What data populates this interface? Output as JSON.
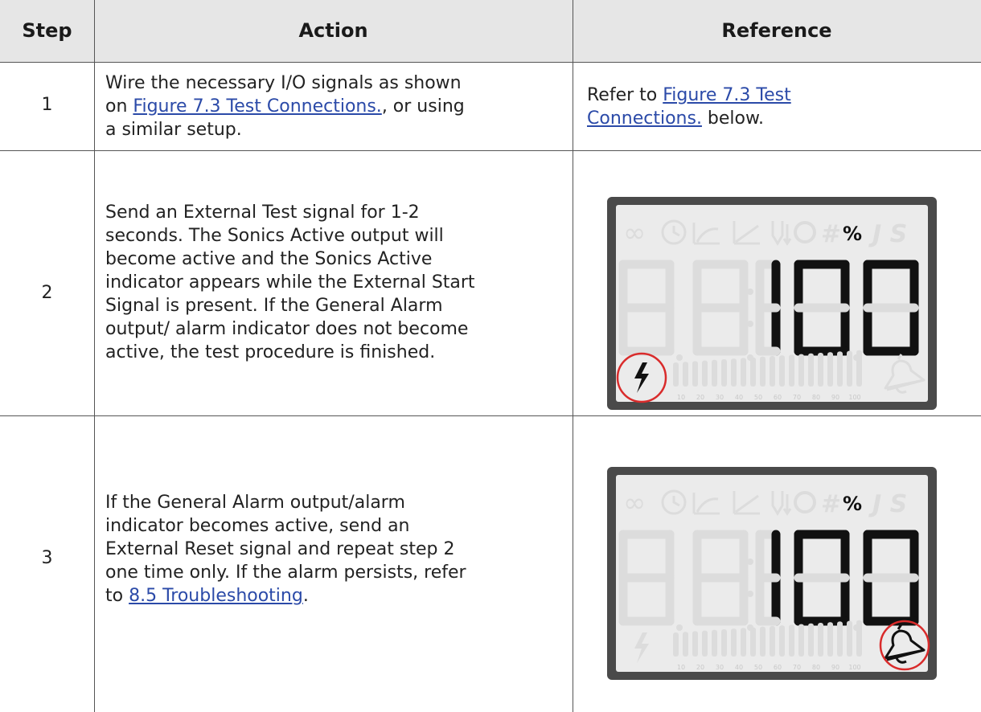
{
  "table": {
    "headers": {
      "step": "Step",
      "action": "Action",
      "reference": "Reference"
    },
    "rows": [
      {
        "step": "1",
        "action_lines": [
          "Wire the necessary I/O signals as shown",
          {
            "pre": "on ",
            "link": "Figure 7.3 Test Connections.",
            "post": ", or using"
          },
          "a similar setup."
        ],
        "reference": {
          "pre": "Refer to ",
          "link_line1": "Figure 7.3 Test ",
          "link_line2": "Connections.",
          "post": " below."
        }
      },
      {
        "step": "2",
        "action_lines": [
          "Send an External Test signal for 1-2",
          "seconds. The Sonics Active output will",
          "become active and the Sonics Active",
          "indicator appears while the External Start",
          "Signal is present. If the General Alarm",
          "output/ alarm indicator does not become",
          "active, the test procedure is finished."
        ],
        "display": {
          "symbols": "∞",
          "percent": "%",
          "letters": "J S",
          "digits": "100",
          "highlight": "lightning-icon",
          "bar_scale": [
            "10",
            "20",
            "30",
            "40",
            "50",
            "60",
            "70",
            "80",
            "90",
            "100"
          ]
        }
      },
      {
        "step": "3",
        "action_lines": [
          "If the General Alarm output/alarm",
          "indicator becomes active, send an",
          "External Reset signal and repeat step 2",
          "one time only. If the alarm persists, refer",
          {
            "pre": "to ",
            "link": "8.5 Troubleshooting",
            "post": "."
          }
        ],
        "display": {
          "symbols": "∞",
          "percent": "%",
          "letters": "J S",
          "digits": "100",
          "highlight": "bell-icon",
          "bar_scale": [
            "10",
            "20",
            "30",
            "40",
            "50",
            "60",
            "70",
            "80",
            "90",
            "100"
          ]
        }
      }
    ]
  },
  "colors": {
    "header_bg": "#e6e6e6",
    "link": "#2b4aa8",
    "lcd_frame": "#4a4a4a",
    "lcd_bg": "#ebebeb",
    "highlight_circle": "#d92b2b"
  }
}
